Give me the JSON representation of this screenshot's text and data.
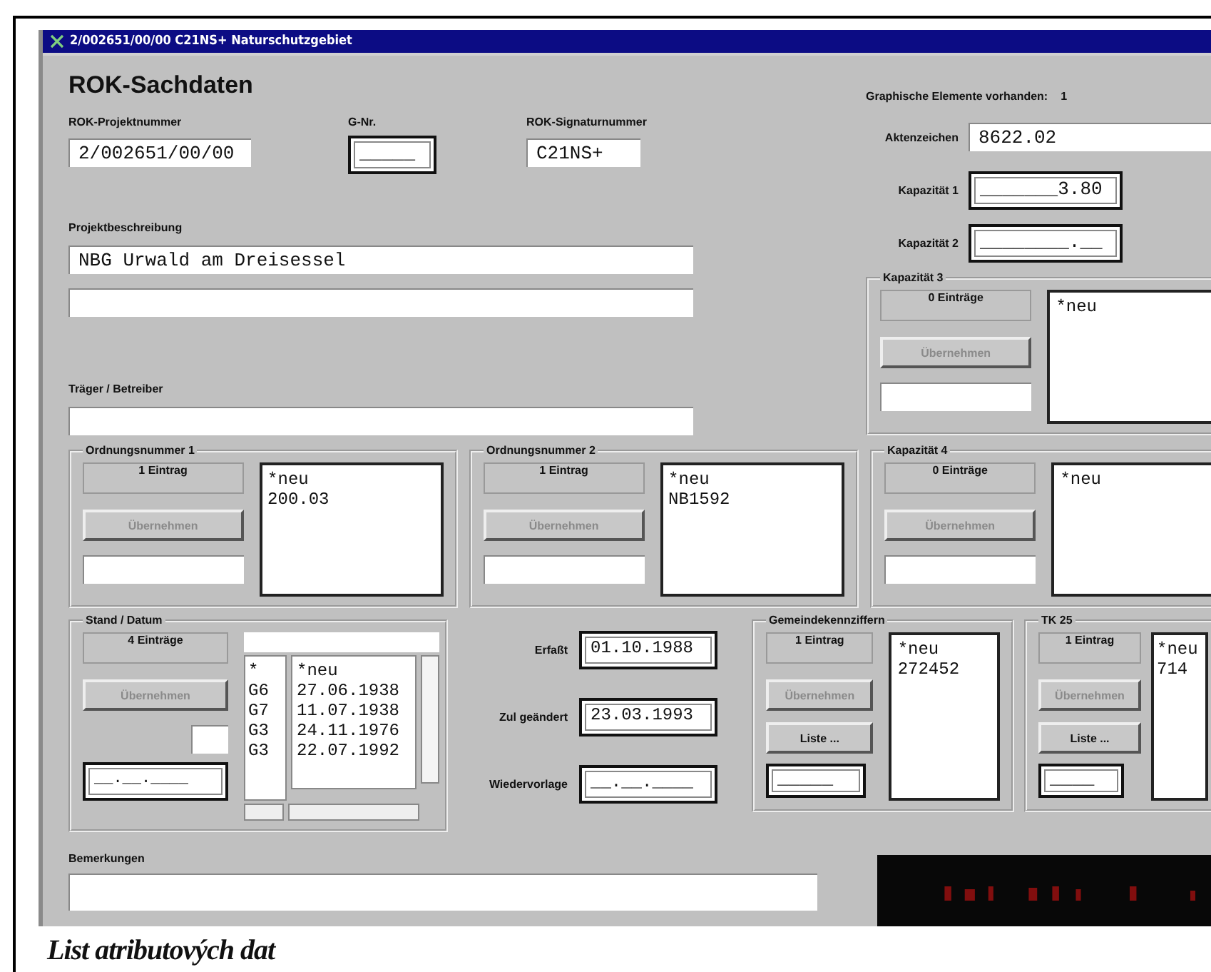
{
  "window": {
    "title": "2/002651/00/00 C21NS+ Naturschutzgebiet"
  },
  "heading": "ROK-Sachdaten",
  "top_fields": [
    {
      "label": "ROK-Projektnummer",
      "value": "2/002651/00/00",
      "kind": "plain"
    },
    {
      "label": "G-Nr.",
      "value": "_____",
      "kind": "framed"
    },
    {
      "label": "ROK-Signaturnummer",
      "value": "C21NS+",
      "kind": "plain"
    }
  ],
  "graphics_info": {
    "label": "Graphische Elemente vorhanden:",
    "value": "1"
  },
  "right_fields": [
    {
      "label": "Aktenzeichen",
      "value": "8622.02",
      "kind": "plain"
    },
    {
      "label": "Kapazität 1",
      "value": "_______3.80",
      "kind": "framed"
    },
    {
      "label": "Kapazität 2",
      "value": "________.__",
      "kind": "framed"
    }
  ],
  "description": {
    "label": "Projektbeschreibung",
    "value": "NBG Urwald am Dreisessel"
  },
  "operator": {
    "label": "Träger / Betreiber"
  },
  "groups": [
    {
      "title": "Kapazität 3",
      "count": "0 Einträge",
      "take_label": "Übernehmen",
      "take_disabled": true,
      "items": [
        "*neu"
      ]
    },
    {
      "title": "Ordnungsnummer 1",
      "count": "1 Eintrag",
      "take_label": "Übernehmen",
      "take_disabled": true,
      "items": [
        "*neu",
        "200.03"
      ]
    },
    {
      "title": "Ordnungsnummer 2",
      "count": "1 Eintrag",
      "take_label": "Übernehmen",
      "take_disabled": true,
      "items": [
        "*neu",
        "NB1592"
      ]
    },
    {
      "title": "Kapazität 4",
      "count": "0 Einträge",
      "take_label": "Übernehmen",
      "take_disabled": true,
      "items": [
        "*neu"
      ]
    }
  ],
  "stand": {
    "title": "Stand / Datum",
    "count": "4 Einträge",
    "take_label": "Übernehmen",
    "take_disabled": true,
    "date_value": "__.__.____",
    "rows": [
      {
        "code": "*",
        "date": "*neu"
      },
      {
        "code": "G6",
        "date": "27.06.1938"
      },
      {
        "code": "G7",
        "date": "11.07.1938"
      },
      {
        "code": "G3",
        "date": "24.11.1976"
      },
      {
        "code": "G3",
        "date": "22.07.1992"
      }
    ]
  },
  "dates": [
    {
      "label": "Erfaßt",
      "value": "01.10.1988"
    },
    {
      "label": "Zul geändert",
      "value": "23.03.1993"
    },
    {
      "label": "Wiedervorlage",
      "value": "__.__.____"
    }
  ],
  "code_groups": [
    {
      "title": "Gemeindekennziffern",
      "count": "1 Eintrag",
      "take_label": "Übernehmen",
      "take_disabled": true,
      "list_label": "Liste ...",
      "code_value": "_____",
      "items": [
        "*neu",
        "272452"
      ]
    },
    {
      "title": "TK 25",
      "count": "1 Eintrag",
      "take_label": "Übernehmen",
      "take_disabled": true,
      "list_label": "Liste ...",
      "code_value": "____",
      "items": [
        "*neu",
        "714"
      ]
    }
  ],
  "remarks": {
    "label": "Bemerkungen"
  },
  "caption": "List atributových dat"
}
